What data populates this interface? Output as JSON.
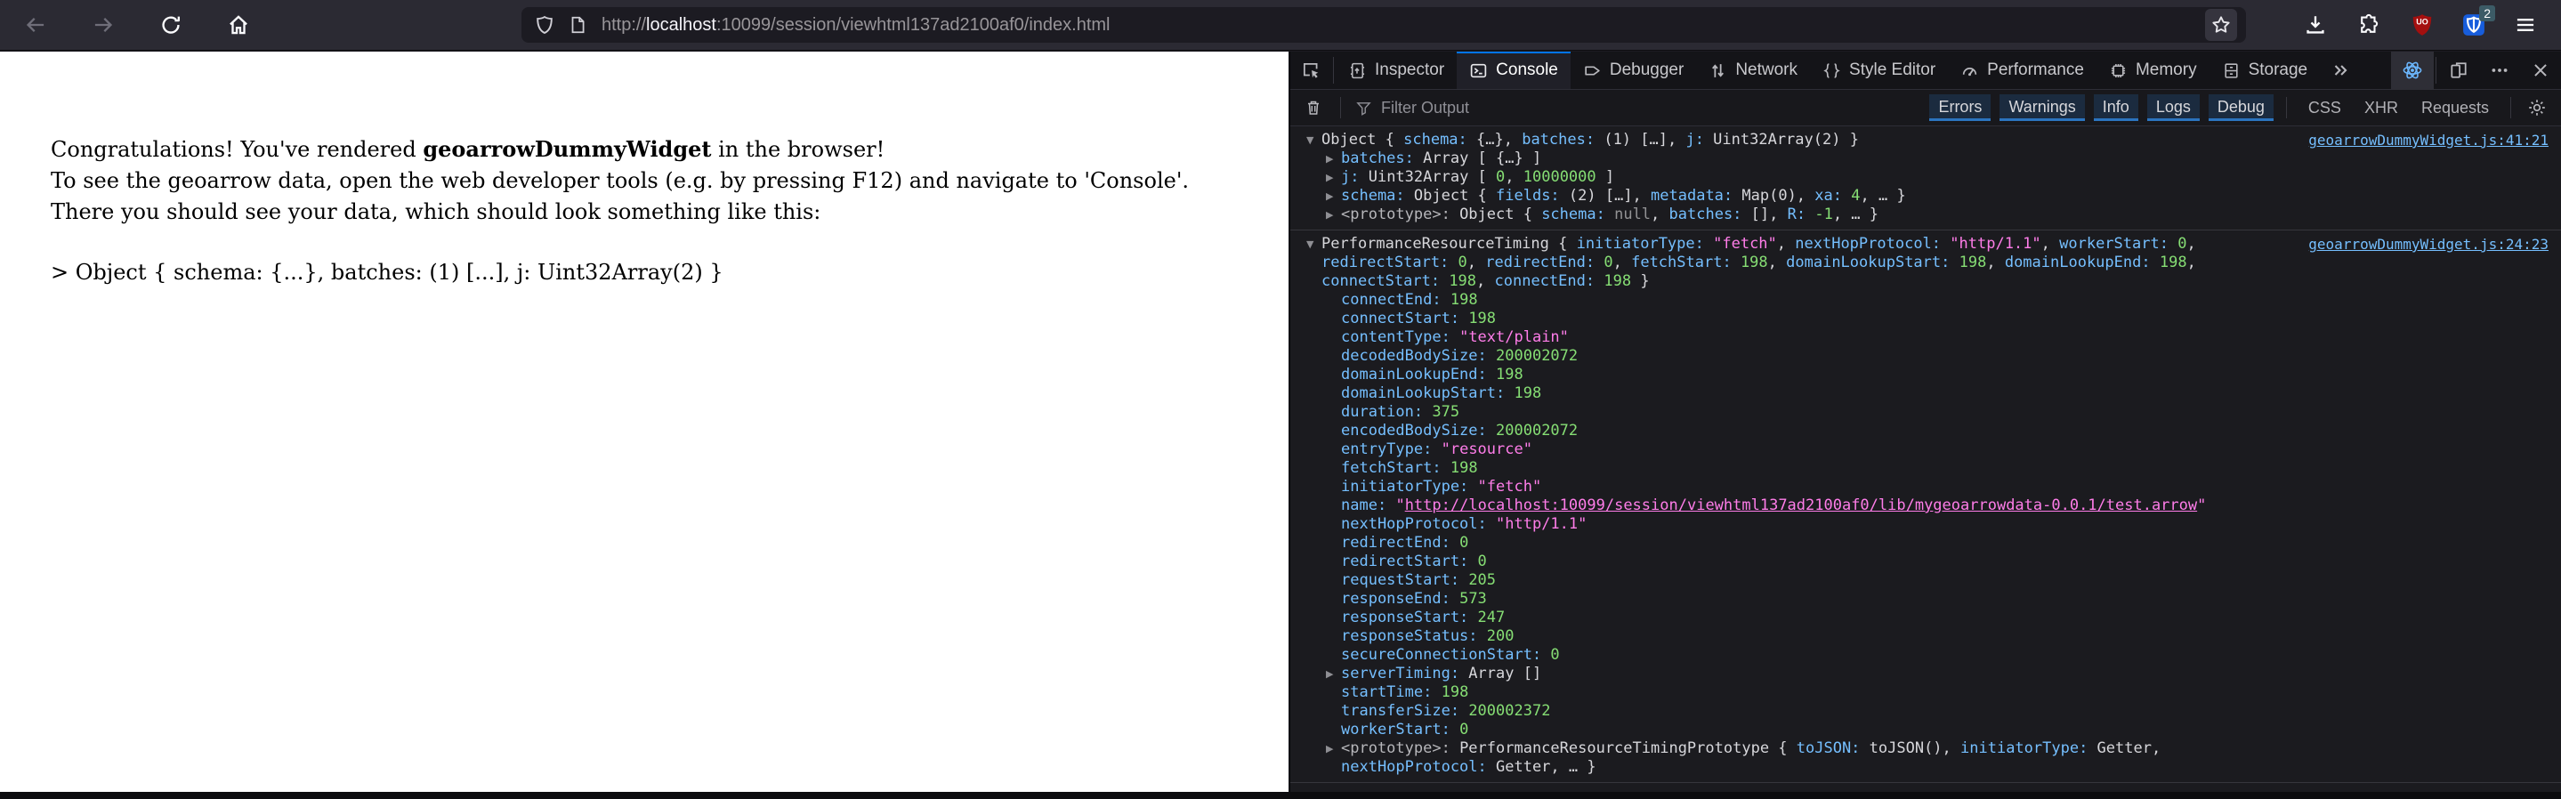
{
  "browser": {
    "url": {
      "prefix": "http://",
      "host": "localhost",
      "rest": ":10099/session/viewhtml137ad2100af0/index.html"
    },
    "nav_icons": [
      "back-icon",
      "forward-icon",
      "reload-icon",
      "home-icon"
    ],
    "urlbar_icons": [
      "shield-icon",
      "page-info-icon",
      "bookmark-star-icon"
    ],
    "right_icons": [
      "download-icon",
      "extensions-puzzle-icon",
      "ublock-shield-icon",
      "bitwarden-shield-icon",
      "menu-hamburger-icon"
    ],
    "ublock_letters": "UO",
    "bitwarden_badge": "2"
  },
  "page": {
    "line1_pre": "Congratulations! You've rendered ",
    "line1_bold": "geoarrowDummyWidget",
    "line1_post": " in the browser!",
    "line2": "To see the geoarrow data, open the web developer tools (e.g. by pressing F12) and navigate to 'Console'.",
    "line3": "There you should see your data, which should look something like this:",
    "example": "> Object { schema: {...}, batches: (1) [...], j: Uint32Array(2) }"
  },
  "devtools": {
    "tabs": [
      "Inspector",
      "Console",
      "Debugger",
      "Network",
      "Style Editor",
      "Performance",
      "Memory",
      "Storage"
    ],
    "active_tab": "Console",
    "toolbar_icons": [
      "pick-element-icon",
      "overflow-chevron-icon",
      "extension-atom-icon",
      "responsive-design-icon",
      "meatball-menu-icon",
      "close-icon"
    ],
    "filter": {
      "placeholder": "Filter Output",
      "icons": [
        "trash-icon",
        "funnel-icon",
        "settings-gear-icon"
      ],
      "toggles": [
        "Errors",
        "Warnings",
        "Info",
        "Logs",
        "Debug"
      ],
      "categories": [
        "CSS",
        "XHR",
        "Requests"
      ]
    },
    "colors": {
      "accent_blue": "#0074e8",
      "key_blue": "#75bfff",
      "number_green": "#86de74",
      "string_pink": "#ff7de9",
      "link_blue": "#75bfff"
    },
    "console_entries": [
      {
        "link": "geoarrowDummyWidget.js:41:21",
        "lines": [
          {
            "indent": 0,
            "twisty": "open",
            "tokens": [
              [
                "plain",
                "Object { "
              ],
              [
                "key",
                "schema:"
              ],
              [
                "plain",
                " {…}, "
              ],
              [
                "key",
                "batches:"
              ],
              [
                "plain",
                " (1) […], "
              ],
              [
                "key",
                "j:"
              ],
              [
                "plain",
                " Uint32Array(2) }"
              ]
            ]
          },
          {
            "indent": 1,
            "twisty": "closed",
            "tokens": [
              [
                "key",
                "batches:"
              ],
              [
                "plain",
                " Array [ {…} ]"
              ]
            ]
          },
          {
            "indent": 1,
            "twisty": "closed",
            "tokens": [
              [
                "key",
                "j:"
              ],
              [
                "plain",
                " Uint32Array [ "
              ],
              [
                "num",
                "0"
              ],
              [
                "plain",
                ", "
              ],
              [
                "num",
                "10000000"
              ],
              [
                "plain",
                " ]"
              ]
            ]
          },
          {
            "indent": 1,
            "twisty": "closed",
            "tokens": [
              [
                "key",
                "schema:"
              ],
              [
                "plain",
                " Object { "
              ],
              [
                "key",
                "fields:"
              ],
              [
                "plain",
                " (2) […], "
              ],
              [
                "key",
                "metadata:"
              ],
              [
                "plain",
                " Map(0), "
              ],
              [
                "key",
                "xa:"
              ],
              [
                "plain",
                " "
              ],
              [
                "num",
                "4"
              ],
              [
                "plain",
                ", … }"
              ]
            ]
          },
          {
            "indent": 1,
            "twisty": "closed",
            "tokens": [
              [
                "proto",
                "<prototype>:"
              ],
              [
                "plain",
                " Object { "
              ],
              [
                "key",
                "schema:"
              ],
              [
                "plain",
                " "
              ],
              [
                "dim",
                "null"
              ],
              [
                "plain",
                ", "
              ],
              [
                "key",
                "batches:"
              ],
              [
                "plain",
                " [], "
              ],
              [
                "key",
                "R:"
              ],
              [
                "plain",
                " "
              ],
              [
                "num",
                "-1"
              ],
              [
                "plain",
                ", … }"
              ]
            ]
          }
        ]
      },
      {
        "link": "geoarrowDummyWidget.js:24:23",
        "lines": [
          {
            "indent": 0,
            "twisty": "open",
            "tokens": [
              [
                "plain",
                "PerformanceResourceTiming { "
              ],
              [
                "key",
                "initiatorType:"
              ],
              [
                "plain",
                " "
              ],
              [
                "str",
                "\"fetch\""
              ],
              [
                "plain",
                ", "
              ],
              [
                "key",
                "nextHopProtocol:"
              ],
              [
                "plain",
                " "
              ],
              [
                "str",
                "\"http/1.1\""
              ],
              [
                "plain",
                ", "
              ],
              [
                "key",
                "workerStart:"
              ],
              [
                "plain",
                " "
              ],
              [
                "num",
                "0"
              ],
              [
                "plain",
                ", "
              ],
              [
                "key",
                "redirectStart:"
              ],
              [
                "plain",
                " "
              ],
              [
                "num",
                "0"
              ],
              [
                "plain",
                ", "
              ],
              [
                "key",
                "redirectEnd:"
              ],
              [
                "plain",
                " "
              ],
              [
                "num",
                "0"
              ],
              [
                "plain",
                ", "
              ],
              [
                "key",
                "fetchStart:"
              ],
              [
                "plain",
                " "
              ],
              [
                "num",
                "198"
              ],
              [
                "plain",
                ", "
              ],
              [
                "key",
                "domainLookupStart:"
              ],
              [
                "plain",
                " "
              ],
              [
                "num",
                "198"
              ],
              [
                "plain",
                ", "
              ],
              [
                "key",
                "domainLookupEnd:"
              ],
              [
                "plain",
                " "
              ],
              [
                "num",
                "198"
              ],
              [
                "plain",
                ", "
              ],
              [
                "key",
                "connectStart:"
              ],
              [
                "plain",
                " "
              ],
              [
                "num",
                "198"
              ],
              [
                "plain",
                ", "
              ],
              [
                "key",
                "connectEnd:"
              ],
              [
                "plain",
                " "
              ],
              [
                "num",
                "198"
              ],
              [
                "plain",
                " }"
              ]
            ]
          },
          {
            "indent": 1,
            "twisty": "none",
            "tokens": [
              [
                "key",
                "connectEnd:"
              ],
              [
                "plain",
                " "
              ],
              [
                "num",
                "198"
              ]
            ]
          },
          {
            "indent": 1,
            "twisty": "none",
            "tokens": [
              [
                "key",
                "connectStart:"
              ],
              [
                "plain",
                " "
              ],
              [
                "num",
                "198"
              ]
            ]
          },
          {
            "indent": 1,
            "twisty": "none",
            "tokens": [
              [
                "key",
                "contentType:"
              ],
              [
                "plain",
                " "
              ],
              [
                "str",
                "\"text/plain\""
              ]
            ]
          },
          {
            "indent": 1,
            "twisty": "none",
            "tokens": [
              [
                "key",
                "decodedBodySize:"
              ],
              [
                "plain",
                " "
              ],
              [
                "num",
                "200002072"
              ]
            ]
          },
          {
            "indent": 1,
            "twisty": "none",
            "tokens": [
              [
                "key",
                "domainLookupEnd:"
              ],
              [
                "plain",
                " "
              ],
              [
                "num",
                "198"
              ]
            ]
          },
          {
            "indent": 1,
            "twisty": "none",
            "tokens": [
              [
                "key",
                "domainLookupStart:"
              ],
              [
                "plain",
                " "
              ],
              [
                "num",
                "198"
              ]
            ]
          },
          {
            "indent": 1,
            "twisty": "none",
            "tokens": [
              [
                "key",
                "duration:"
              ],
              [
                "plain",
                " "
              ],
              [
                "num",
                "375"
              ]
            ]
          },
          {
            "indent": 1,
            "twisty": "none",
            "tokens": [
              [
                "key",
                "encodedBodySize:"
              ],
              [
                "plain",
                " "
              ],
              [
                "num",
                "200002072"
              ]
            ]
          },
          {
            "indent": 1,
            "twisty": "none",
            "tokens": [
              [
                "key",
                "entryType:"
              ],
              [
                "plain",
                " "
              ],
              [
                "str",
                "\"resource\""
              ]
            ]
          },
          {
            "indent": 1,
            "twisty": "none",
            "tokens": [
              [
                "key",
                "fetchStart:"
              ],
              [
                "plain",
                " "
              ],
              [
                "num",
                "198"
              ]
            ]
          },
          {
            "indent": 1,
            "twisty": "none",
            "tokens": [
              [
                "key",
                "initiatorType:"
              ],
              [
                "plain",
                " "
              ],
              [
                "str",
                "\"fetch\""
              ]
            ]
          },
          {
            "indent": 1,
            "twisty": "none",
            "tokens": [
              [
                "key",
                "name:"
              ],
              [
                "plain",
                " "
              ],
              [
                "str",
                "\""
              ],
              [
                "strlink",
                "http://localhost:10099/session/viewhtml137ad2100af0/lib/mygeoarrowdata-0.0.1/test.arrow"
              ],
              [
                "str",
                "\""
              ]
            ]
          },
          {
            "indent": 1,
            "twisty": "none",
            "tokens": [
              [
                "key",
                "nextHopProtocol:"
              ],
              [
                "plain",
                " "
              ],
              [
                "str",
                "\"http/1.1\""
              ]
            ]
          },
          {
            "indent": 1,
            "twisty": "none",
            "tokens": [
              [
                "key",
                "redirectEnd:"
              ],
              [
                "plain",
                " "
              ],
              [
                "num",
                "0"
              ]
            ]
          },
          {
            "indent": 1,
            "twisty": "none",
            "tokens": [
              [
                "key",
                "redirectStart:"
              ],
              [
                "plain",
                " "
              ],
              [
                "num",
                "0"
              ]
            ]
          },
          {
            "indent": 1,
            "twisty": "none",
            "tokens": [
              [
                "key",
                "requestStart:"
              ],
              [
                "plain",
                " "
              ],
              [
                "num",
                "205"
              ]
            ]
          },
          {
            "indent": 1,
            "twisty": "none",
            "tokens": [
              [
                "key",
                "responseEnd:"
              ],
              [
                "plain",
                " "
              ],
              [
                "num",
                "573"
              ]
            ]
          },
          {
            "indent": 1,
            "twisty": "none",
            "tokens": [
              [
                "key",
                "responseStart:"
              ],
              [
                "plain",
                " "
              ],
              [
                "num",
                "247"
              ]
            ]
          },
          {
            "indent": 1,
            "twisty": "none",
            "tokens": [
              [
                "key",
                "responseStatus:"
              ],
              [
                "plain",
                " "
              ],
              [
                "num",
                "200"
              ]
            ]
          },
          {
            "indent": 1,
            "twisty": "none",
            "tokens": [
              [
                "key",
                "secureConnectionStart:"
              ],
              [
                "plain",
                " "
              ],
              [
                "num",
                "0"
              ]
            ]
          },
          {
            "indent": 1,
            "twisty": "closed",
            "tokens": [
              [
                "key",
                "serverTiming:"
              ],
              [
                "plain",
                " Array []"
              ]
            ]
          },
          {
            "indent": 1,
            "twisty": "none",
            "tokens": [
              [
                "key",
                "startTime:"
              ],
              [
                "plain",
                " "
              ],
              [
                "num",
                "198"
              ]
            ]
          },
          {
            "indent": 1,
            "twisty": "none",
            "tokens": [
              [
                "key",
                "transferSize:"
              ],
              [
                "plain",
                " "
              ],
              [
                "num",
                "200002372"
              ]
            ]
          },
          {
            "indent": 1,
            "twisty": "none",
            "tokens": [
              [
                "key",
                "workerStart:"
              ],
              [
                "plain",
                " "
              ],
              [
                "num",
                "0"
              ]
            ]
          },
          {
            "indent": 1,
            "twisty": "closed",
            "tokens": [
              [
                "proto",
                "<prototype>:"
              ],
              [
                "plain",
                " PerformanceResourceTimingPrototype { "
              ],
              [
                "key",
                "toJSON:"
              ],
              [
                "plain",
                " toJSON(), "
              ],
              [
                "key",
                "initiatorType:"
              ],
              [
                "plain",
                " Getter, "
              ],
              [
                "key",
                "nextHopProtocol:"
              ],
              [
                "plain",
                " Getter, … }"
              ]
            ]
          }
        ]
      }
    ]
  }
}
